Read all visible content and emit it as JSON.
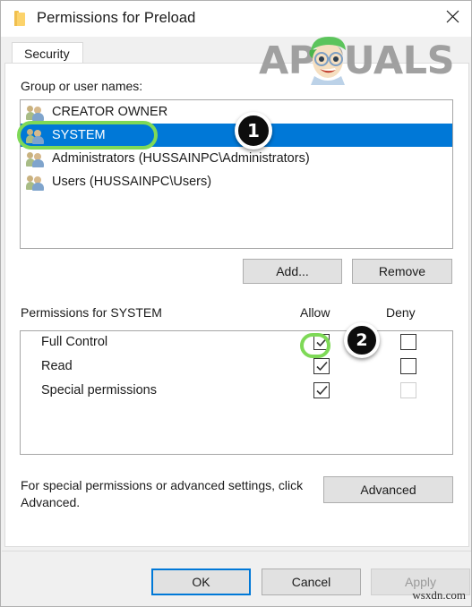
{
  "window": {
    "title": "Permissions for Preload",
    "icon": "folder-icon",
    "close_label": "✕"
  },
  "tabs": [
    {
      "label": "Security",
      "active": true
    }
  ],
  "groups_section": {
    "label": "Group or user names:",
    "items": [
      {
        "name": "CREATOR OWNER",
        "selected": false,
        "icon": "users-group-icon"
      },
      {
        "name": "SYSTEM",
        "selected": true,
        "icon": "users-group-icon"
      },
      {
        "name": "Administrators (HUSSAINPC\\Administrators)",
        "selected": false,
        "icon": "users-group-icon"
      },
      {
        "name": "Users (HUSSAINPC\\Users)",
        "selected": false,
        "icon": "users-group-icon"
      }
    ],
    "buttons": {
      "add": "Add...",
      "remove": "Remove"
    }
  },
  "permissions_section": {
    "label": "Permissions for SYSTEM",
    "columns": {
      "allow": "Allow",
      "deny": "Deny"
    },
    "rows": [
      {
        "name": "Full Control",
        "allow": true,
        "deny": false,
        "deny_enabled": true
      },
      {
        "name": "Read",
        "allow": true,
        "deny": false,
        "deny_enabled": true
      },
      {
        "name": "Special permissions",
        "allow": true,
        "deny": false,
        "deny_enabled": false
      }
    ]
  },
  "footer": {
    "help_text": "For special permissions or advanced settings, click Advanced.",
    "advanced_button": "Advanced"
  },
  "dialog_buttons": {
    "ok": "OK",
    "cancel": "Cancel",
    "apply": "Apply"
  },
  "annotations": {
    "badge_1": "1",
    "badge_2": "2"
  },
  "watermarks": {
    "brand": "APPUALS",
    "site": "wsxdn.com"
  },
  "colors": {
    "selection_blue": "#0078d7",
    "highlight_green": "#7ed957",
    "badge_black": "#0d0d0d",
    "dialog_face": "#f0f0f0"
  }
}
